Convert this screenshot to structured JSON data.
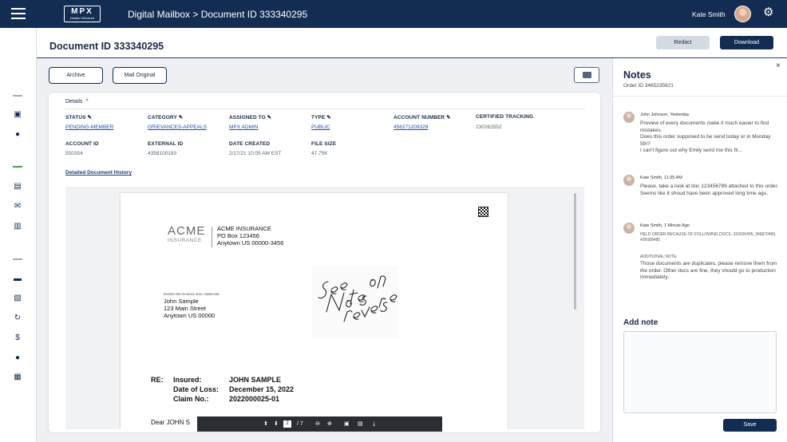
{
  "app": {
    "logo_main": "MPX",
    "logo_tag": "Details Delivered",
    "title": "Digital Mailbox > Document ID 333340295",
    "user_name": "Kate Smith"
  },
  "page": {
    "title": "Document ID 333340295",
    "redact_label": "Redact",
    "download_label": "Download",
    "archive_label": "Archive",
    "mail_original_label": "Mail Original"
  },
  "details": {
    "toggle_label": "Details",
    "toggle_icon": "^",
    "status_label": "STATUS",
    "status_value": "PENDING-MEMBER",
    "category_label": "CATEGORY",
    "category_value": "GRIEVANCES-APPEALS",
    "assigned_label": "ASSIGNED TO",
    "assigned_value": "MPX ADMIN",
    "type_label": "TYPE",
    "type_value": "PUBLIC",
    "account_number_label": "ACCOUNT NUMBER",
    "account_number_value": "456271209329",
    "certified_label": "CERTIFIED TRACKING",
    "certified_value": "230263552",
    "account_id_label": "ACCOUNT ID",
    "account_id_value": "550354",
    "external_id_label": "EXTERNAL ID",
    "external_id_value": "4358100183",
    "date_created_label": "DATE CREATED",
    "date_created_value": "2/17/21 10:05 AM EST",
    "file_size_label": "FILE SIZE",
    "file_size_value": "47.75K",
    "history_link": "Detailed Document History"
  },
  "letter": {
    "logo_text": "ACME",
    "logo_sub": "INSURANCE",
    "company_name": "ACME INSURANCE",
    "company_po": "PO Box 123456",
    "company_city": "Anytown US 00000-3456",
    "barcode_text": "999999 999 99 00001 0001 YNNNYNB",
    "recipient_name": "John Sample",
    "recipient_street": "123 Main Street",
    "recipient_city": "Anytown US 00000",
    "handwriting": "See Notes on reverse",
    "re_label": "RE:",
    "insured_label": "Insured:",
    "insured_value": "JOHN SAMPLE",
    "date_of_loss_label": "Date of Loss:",
    "date_of_loss_value": "December 15, 2022",
    "claim_label": "Claim No.:",
    "claim_value": "2022000025-01",
    "greeting": "Dear JOHN S"
  },
  "pdf_toolbar": {
    "current_page": "2",
    "total_pages": "/ 7"
  },
  "notes": {
    "title": "Notes",
    "order_id": "Order ID 3465235621",
    "close": "×",
    "items": [
      {
        "author": "John Johnson, Yesterday",
        "line1": "Preview of every documents make it much easier to find mistakes.",
        "line2": "Does this order supposed to be send today or in Monday 5th?",
        "line3": "I can't figure out why Emily send me this fil..."
      },
      {
        "author": "Kate Smith, 11:35 AM",
        "line1": "Please, take a look at doc 123456789 attached to this order. Seems like it shoud have been approved long time ago."
      },
      {
        "author": "Kate Smith, 1 Minute Ago",
        "line1": "HELD ORDER BECAUSE OF FOLLOWING DOCS: 333336455, 346879485, 436089485",
        "line2": "ADDITIONAL NOTE:",
        "line3": "Those documents are duplicates, please remove them from the order. Other docs are fine, they should go to production immediately."
      }
    ],
    "add_note_title": "Add note",
    "save_label": "Save"
  },
  "icons": {
    "menu": "hamburger-icon",
    "settings": "gear-icon",
    "comment": "comment-icon",
    "edit": "pencil-icon",
    "qr": "qr-code-icon"
  },
  "colors": {
    "primary": "#132d52",
    "link": "#1f4fa0",
    "accent_green": "#3fa34d"
  }
}
